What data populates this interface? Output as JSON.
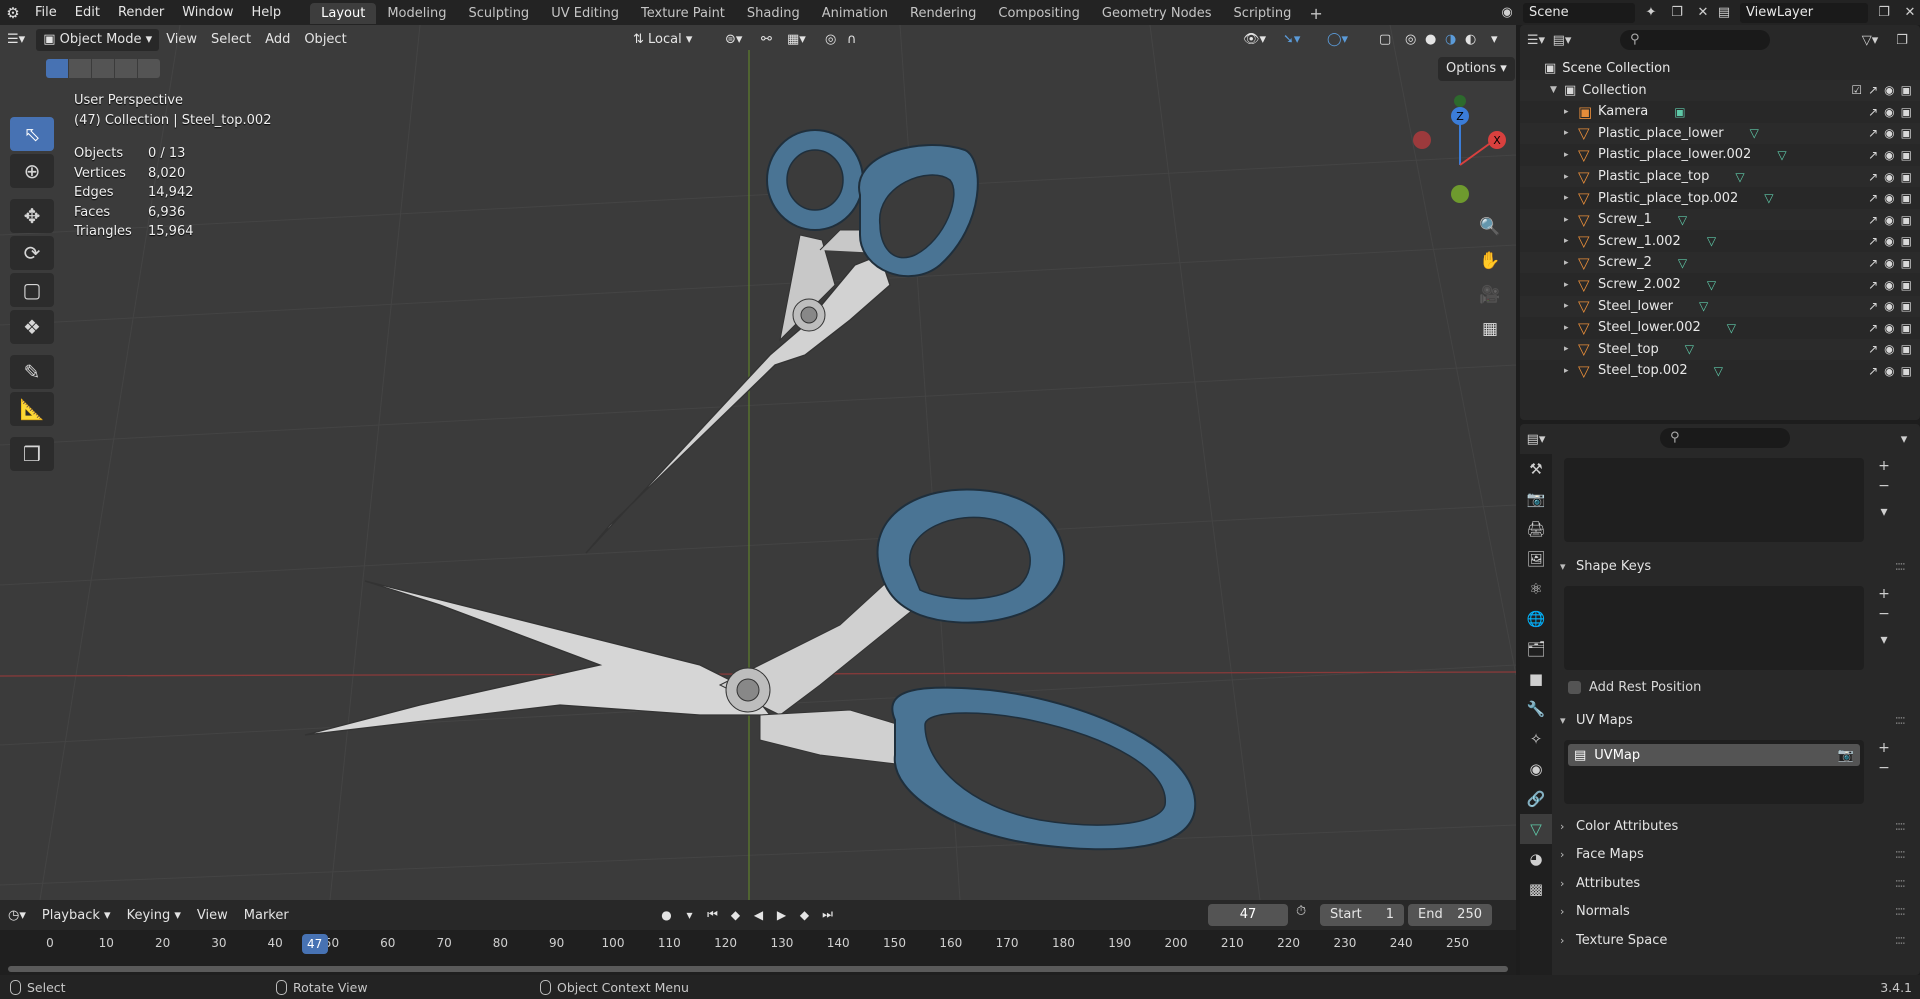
{
  "topbar": {
    "menus": [
      "File",
      "Edit",
      "Render",
      "Window",
      "Help"
    ],
    "workspaces": [
      "Layout",
      "Modeling",
      "Sculpting",
      "UV Editing",
      "Texture Paint",
      "Shading",
      "Animation",
      "Rendering",
      "Compositing",
      "Geometry Nodes",
      "Scripting"
    ],
    "active_workspace": "Layout",
    "add_tab": "+",
    "scene": "Scene",
    "view_layer": "ViewLayer"
  },
  "viewport": {
    "mode": "Object Mode",
    "menus": [
      "View",
      "Select",
      "Add",
      "Object"
    ],
    "transform_orientation": "Local",
    "options": "Options",
    "perspective": "User Perspective",
    "context": "(47) Collection | Steel_top.002",
    "stats": [
      {
        "label": "Objects",
        "value": "0 / 13"
      },
      {
        "label": "Vertices",
        "value": "8,020"
      },
      {
        "label": "Edges",
        "value": "14,942"
      },
      {
        "label": "Faces",
        "value": "6,936"
      },
      {
        "label": "Triangles",
        "value": "15,964"
      }
    ],
    "gizmo": {
      "z": "Z",
      "x": "X"
    },
    "tools": [
      "select-box",
      "cursor",
      "move",
      "rotate",
      "scale",
      "transform",
      "annotate",
      "measure",
      "add-cube"
    ]
  },
  "timeline": {
    "menus": [
      "Playback",
      "Keying",
      "View",
      "Marker"
    ],
    "current_frame": "47",
    "start_label": "Start",
    "start": "1",
    "end_label": "End",
    "end": "250",
    "ticks": [
      "0",
      "10",
      "20",
      "30",
      "40",
      "50",
      "60",
      "70",
      "80",
      "90",
      "100",
      "110",
      "120",
      "130",
      "140",
      "150",
      "160",
      "170",
      "180",
      "190",
      "200",
      "210",
      "220",
      "230",
      "240",
      "250"
    ]
  },
  "statusbar": {
    "select": "Select",
    "rotate": "Rotate View",
    "context_menu": "Object Context Menu",
    "version": "3.4.1"
  },
  "outliner": {
    "scene_collection": "Scene Collection",
    "collection": "Collection",
    "items": [
      {
        "name": "Kamera",
        "type": "camera"
      },
      {
        "name": "Plastic_place_lower",
        "type": "mesh"
      },
      {
        "name": "Plastic_place_lower.002",
        "type": "mesh"
      },
      {
        "name": "Plastic_place_top",
        "type": "mesh"
      },
      {
        "name": "Plastic_place_top.002",
        "type": "mesh"
      },
      {
        "name": "Screw_1",
        "type": "mesh"
      },
      {
        "name": "Screw_1.002",
        "type": "mesh"
      },
      {
        "name": "Screw_2",
        "type": "mesh"
      },
      {
        "name": "Screw_2.002",
        "type": "mesh"
      },
      {
        "name": "Steel_lower",
        "type": "mesh"
      },
      {
        "name": "Steel_lower.002",
        "type": "mesh"
      },
      {
        "name": "Steel_top",
        "type": "mesh"
      },
      {
        "name": "Steel_top.002",
        "type": "mesh"
      }
    ]
  },
  "properties": {
    "shape_keys": "Shape Keys",
    "add_rest_position": "Add Rest Position",
    "uv_maps": "UV Maps",
    "uv_map_name": "UVMap",
    "color_attributes": "Color Attributes",
    "face_maps": "Face Maps",
    "attributes": "Attributes",
    "normals": "Normals",
    "texture_space": "Texture Space"
  },
  "colors": {
    "accent": "#4772b3",
    "mesh": "#e58c3a",
    "data": "#5fc9a8",
    "handle": "#4a7494",
    "blade": "#cfcfcf"
  }
}
